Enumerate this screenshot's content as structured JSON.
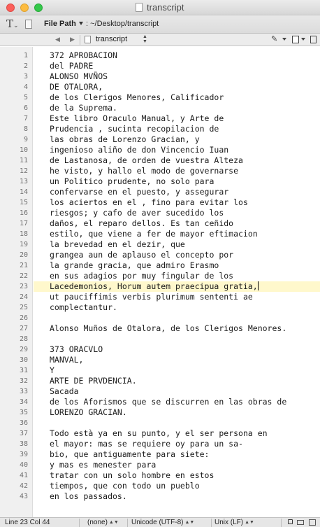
{
  "window": {
    "title": "transcript"
  },
  "toolbar": {
    "file_path_label": "File Path",
    "file_path_value": ": ~/Desktop/transcript"
  },
  "navbar": {
    "file_name": "transcript"
  },
  "editor": {
    "current_line": 23,
    "lines": [
      "372 APROBACION",
      "del PADRE",
      "ALONSO MVÑOS",
      "DE OTALORA,",
      "de los Clerigos Menores, Calificador",
      "de la Suprema.",
      "Este libro Oraculo Manual, y Arte de",
      "Prudencia , sucinta recopilacion de",
      "las obras de Lorenzo Gracian, y",
      "ingenioso aliño de don Vincencio Iuan",
      "de Lastanosa, de orden de vuestra Alteza",
      "he visto, y hallo el modo de governarse",
      "un Politico prudente, no solo para",
      "confervarse en el puesto, y assegurar",
      "los aciertos en el , fino para evitar los",
      "riesgos; y cafo de aver sucedido los",
      "daños, el reparo dellos. Es tan ceñido",
      "estilo, que viene a fer de mayor eftimacion",
      "la brevedad en el dezir, que",
      "grangea aun de aplauso el concepto por",
      "la grande gracia, que admiro Erasmo",
      "en sus adagios por muy fingular de los",
      "Lacedemonios, Horum autem praecipua gratia,",
      "ut pauciffimis verbis plurimum sententi ae",
      "complectantur.",
      "",
      "Alonso Muños de Otalora, de los Clerigos Menores.",
      "",
      "373 ORACVLO",
      "MANVAL,",
      "Y",
      "ARTE DE PRVDENCIA.",
      "Sacada",
      "de los Aforismos que se discurren en las obras de",
      "LORENZO GRACIAN.",
      "",
      "Todo està ya en su punto, y el ser persona en",
      "el mayor: mas se requiere oy para un sa-",
      "bio, que antiguamente para siete:",
      "y mas es menester para",
      "tratar con un solo hombre en estos",
      "tiempos, que con todo un pueblo",
      "en los passados."
    ]
  },
  "statusbar": {
    "position": "Line 23 Col 44",
    "syntax": "(none)",
    "encoding": "Unicode (UTF-8)",
    "line_endings": "Unix (LF)"
  }
}
